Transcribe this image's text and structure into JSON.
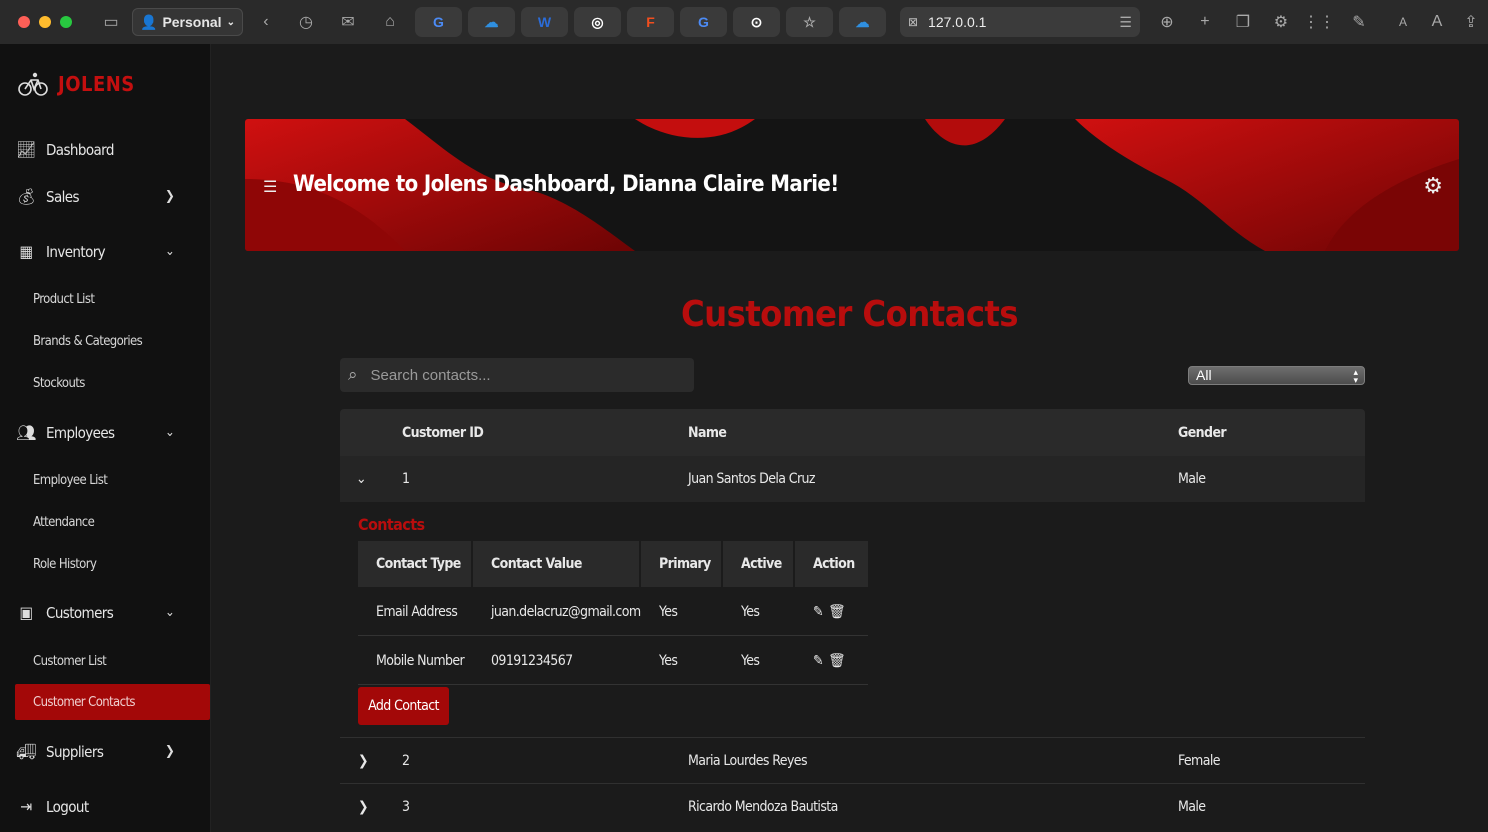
{
  "browser": {
    "profile_label": "Personal",
    "url": "127.0.0.1",
    "pinned_tabs": [
      "G",
      "☁",
      "W",
      "◎",
      "F",
      "G",
      "⊙",
      "☆",
      "☁"
    ]
  },
  "sidebar": {
    "brand": "JOLENS",
    "items": {
      "dashboard": "Dashboard",
      "sales": "Sales",
      "inventory": "Inventory",
      "product_list": "Product List",
      "brands_categories": "Brands & Categories",
      "stockouts": "Stockouts",
      "employees": "Employees",
      "employee_list": "Employee List",
      "attendance": "Attendance",
      "role_history": "Role History",
      "customers": "Customers",
      "customer_list": "Customer List",
      "customer_contacts": "Customer Contacts",
      "suppliers": "Suppliers",
      "logout": "Logout"
    }
  },
  "banner": {
    "title": "Welcome to Jolens Dashboard, Dianna Claire Marie!"
  },
  "page": {
    "title": "Customer Contacts"
  },
  "search": {
    "placeholder": "Search contacts..."
  },
  "filter": {
    "selected": "All"
  },
  "table": {
    "headers": {
      "customer_id": "Customer ID",
      "name": "Name",
      "gender": "Gender"
    },
    "rows": [
      {
        "id": "1",
        "name": "Juan Santos Dela Cruz",
        "gender": "Male"
      },
      {
        "id": "2",
        "name": "Maria Lourdes Reyes",
        "gender": "Female"
      },
      {
        "id": "3",
        "name": "Ricardo Mendoza Bautista",
        "gender": "Male"
      }
    ]
  },
  "contacts": {
    "label": "Contacts",
    "headers": {
      "type": "Contact Type",
      "value": "Contact Value",
      "primary": "Primary",
      "active": "Active",
      "action": "Action"
    },
    "rows": [
      {
        "type": "Email Address",
        "value": "juan.delacruz@gmail.com",
        "primary": "Yes",
        "active": "Yes"
      },
      {
        "type": "Mobile Number",
        "value": "09191234567",
        "primary": "Yes",
        "active": "Yes"
      }
    ],
    "add_label": "Add Contact"
  },
  "colors": {
    "accent": "#b80d0d",
    "active_bg": "#a30808"
  }
}
